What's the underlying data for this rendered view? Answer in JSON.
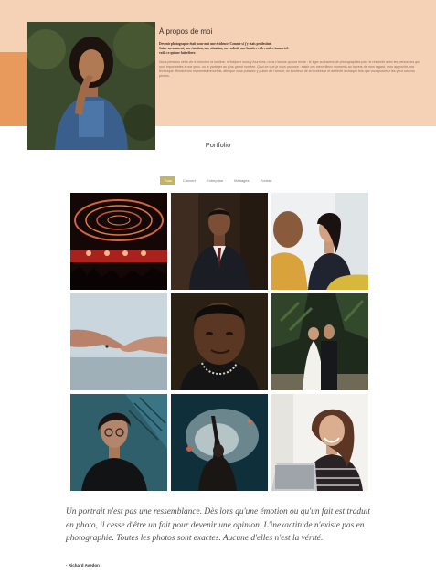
{
  "about": {
    "title": "À propos de moi",
    "lead_lines": [
      "Devenir photographe était pour moi une évidence. Comme si j'y étais prédestiné.",
      "Saisir un moment, une émotion, une situation, un endroit, une lumière et le rendre immortel.",
      "voilà ce qui me fait vibrer."
    ],
    "body": "Nous pensons cette vie à chercher la lumière, m'éclipser nous y fourrions, nous n'avons qu'une envie : le figer au travers de photographies pour le ressentir avec les personnes qui sont importantes à nos yeux, ou le partager au plus grand nombre. Quoi ce que je vous propose : saisir ces merveilleux moments au travers de mon regard, mon approche, ma technique. Rendre ces moments immortels, afin que vous puissiez y puiser de l'amour, du bonheur, de la tendresse et de fierté à chaque fois que vous poserez les yeux sur vos photos."
  },
  "portfolio": {
    "title": "Portfolio",
    "filters": [
      "Tous",
      "Concert",
      "Entreprise",
      "Mariages",
      "Portrait"
    ],
    "active_filter": "Tous",
    "photos": [
      {
        "icon": "concert-stage-photo",
        "category": "Concert"
      },
      {
        "icon": "businessman-suit-photo",
        "category": "Entreprise"
      },
      {
        "icon": "office-meeting-photo",
        "category": "Entreprise"
      },
      {
        "icon": "holding-hands-photo",
        "category": "Mariages"
      },
      {
        "icon": "man-portrait-photo",
        "category": "Portrait"
      },
      {
        "icon": "wedding-couple-photo",
        "category": "Mariages"
      },
      {
        "icon": "woman-glasses-portrait-photo",
        "category": "Portrait"
      },
      {
        "icon": "concert-crowd-photo",
        "category": "Concert"
      },
      {
        "icon": "woman-laptop-photo",
        "category": "Entreprise"
      }
    ]
  },
  "quote": {
    "text": "Un portrait n'est pas une ressemblance. Dès lors qu'une émotion ou qu'un fait est traduit en photo, il cesse d'être un fait pour devenir une opinion. L'inexactitude n'existe pas en photographie. Toutes les photos sont exactes. Aucune d'elles n'est la vérité.",
    "author": "- Richard Avedon"
  },
  "colors": {
    "about_background": "#f5d1b6",
    "accent": "#e89a5d",
    "filter_active": "#c4b560"
  }
}
